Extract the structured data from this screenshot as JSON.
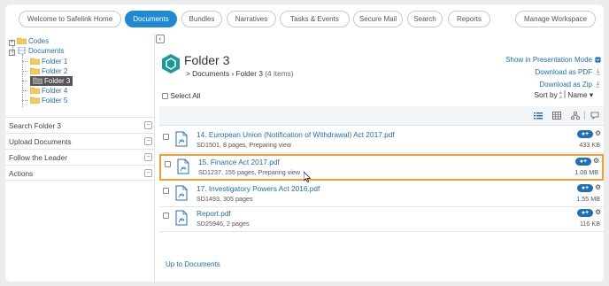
{
  "nav": {
    "tabs": [
      {
        "label": "Welcome to Safelink Home",
        "active": false
      },
      {
        "label": "Documents",
        "active": true
      },
      {
        "label": "Bundles",
        "active": false
      },
      {
        "label": "Narratives",
        "active": false
      },
      {
        "label": "Tasks & Events",
        "active": false
      },
      {
        "label": "Secure Mail",
        "active": false
      },
      {
        "label": "Search",
        "active": false
      },
      {
        "label": "Reports",
        "active": false
      }
    ],
    "manage": "Manage Workspace"
  },
  "tree": {
    "codes": "Codes",
    "documents": "Documents",
    "folders": [
      "Folder 1",
      "Folder 2",
      "Folder 3",
      "Folder 4",
      "Folder 5"
    ],
    "selected": "Folder 3"
  },
  "side": {
    "search": "Search Folder 3",
    "upload": "Upload Documents",
    "follow": "Follow the Leader",
    "actions": "Actions"
  },
  "main": {
    "title": "Folder 3",
    "crumb_prefix": ">",
    "crumb_root": "Documents",
    "crumb_sep": "›",
    "crumb_current": "Folder 3",
    "count": "(4 items)",
    "presentation": "Show in Presentation Mode",
    "download_pdf": "Download as PDF",
    "download_zip": "Download as Zip",
    "select_all": "Select All",
    "sort_by": "Sort by",
    "sort_field": "Name",
    "up_link": "Up to Documents"
  },
  "items": [
    {
      "name": "14. European Union (Notification of Withdrawal) Act 2017.pdf",
      "meta": "SD1501, 8 pages, Preparing view",
      "size": "433 KB",
      "highlighted": false
    },
    {
      "name": "15. Finance Act 2017.pdf",
      "meta": "SD1237, 155 pages, Preparing view",
      "size": "1.08 MB",
      "highlighted": true
    },
    {
      "name": "17. Investigatory Powers Act 2016.pdf",
      "meta": "SD1493, 305 pages",
      "size": "1.55 MB",
      "highlighted": false
    },
    {
      "name": "Report.pdf",
      "meta": "SD25946, 2 pages",
      "size": "116 KB",
      "highlighted": false
    }
  ],
  "tag_label": "+",
  "colors": {
    "accent": "#1f8ad4",
    "link": "#1f6fb8",
    "highlight": "#f0a030",
    "teal": "#1a9a9a"
  }
}
